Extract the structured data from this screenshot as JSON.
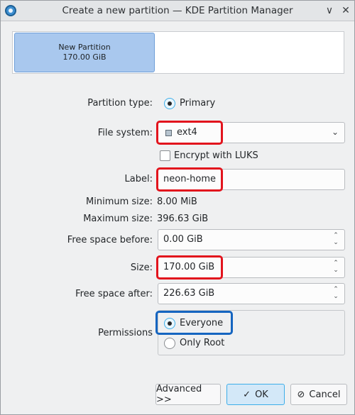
{
  "window": {
    "title": "Create a new partition — KDE Partition Manager",
    "minimize_glyph": "∨",
    "close_glyph": "✕"
  },
  "partition_bar": {
    "name": "New Partition",
    "size": "170.00 GiB"
  },
  "form": {
    "partition_type": {
      "label": "Partition type:",
      "value": "Primary"
    },
    "file_system": {
      "label": "File system:",
      "value": "ext4",
      "arrow": "⌄"
    },
    "encrypt": {
      "label": "Encrypt with LUKS",
      "checked": false
    },
    "name_field": {
      "label": "Label:",
      "value": "neon-home"
    },
    "minimum_size": {
      "label": "Minimum size:",
      "value": "8.00 MiB"
    },
    "maximum_size": {
      "label": "Maximum size:",
      "value": "396.63 GiB"
    },
    "free_before": {
      "label": "Free space before:",
      "value": "0.00 GiB"
    },
    "size": {
      "label": "Size:",
      "value": "170.00 GiB"
    },
    "free_after": {
      "label": "Free space after:",
      "value": "226.63 GiB"
    },
    "permissions": {
      "label": "Permissions",
      "options": [
        "Everyone",
        "Only Root"
      ],
      "selected": "Everyone"
    }
  },
  "spin": {
    "up": "⌃",
    "down": "⌄"
  },
  "buttons": {
    "advanced": "Advanced >>",
    "ok": "OK",
    "ok_glyph": "✓",
    "cancel": "Cancel",
    "cancel_glyph": "⊘"
  },
  "colors": {
    "highlight_red": "#e2141d",
    "highlight_blue": "#1565c0",
    "accent": "#3daee9",
    "partition_fill": "#a9c8ee"
  },
  "icons": [
    "app-icon",
    "minimize-icon",
    "close-icon",
    "filesystem-icon",
    "chevron-down-icon",
    "spin-icon",
    "checkmark-icon",
    "cancel-icon",
    "mouse-cursor-icon"
  ]
}
